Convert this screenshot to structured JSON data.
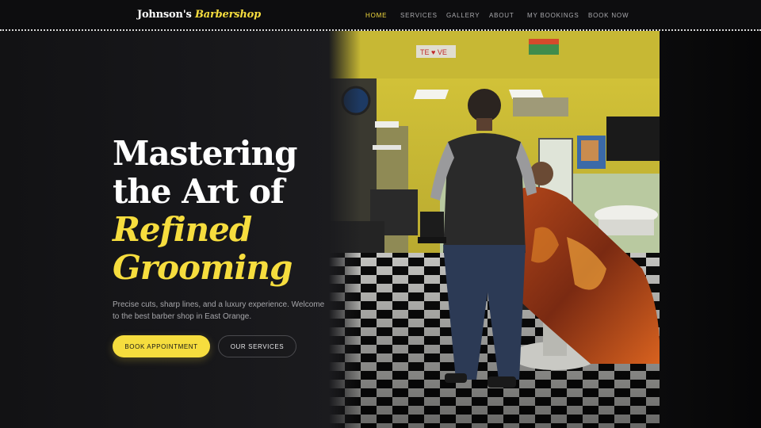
{
  "brand": {
    "name": "Johnson's",
    "accent": "Barbershop"
  },
  "nav": {
    "items": [
      {
        "label": "HOME",
        "active": true
      },
      {
        "label": "SERVICES",
        "active": false
      },
      {
        "label": "GALLERY",
        "active": false
      },
      {
        "label": "ABOUT",
        "active": false
      },
      {
        "label": "MY BOOKINGS",
        "active": false
      },
      {
        "label": "BOOK NOW",
        "active": false
      }
    ]
  },
  "hero": {
    "headline_line1": "Mastering",
    "headline_line2": "the Art of",
    "headline_line3": "Refined",
    "headline_line4": "Grooming",
    "subtitle": "Precise cuts, sharp lines, and a luxury experience. Welcome to the best barber shop in East Orange.",
    "primary_cta": "BOOK APPOINTMENT",
    "secondary_cta": "OUR SERVICES"
  },
  "photo": {
    "sign_text": "TE ♥ VE"
  },
  "colors": {
    "accent": "#f6dd3e",
    "background": "#0b0b0c",
    "muted_text": "#a6a6aa"
  }
}
